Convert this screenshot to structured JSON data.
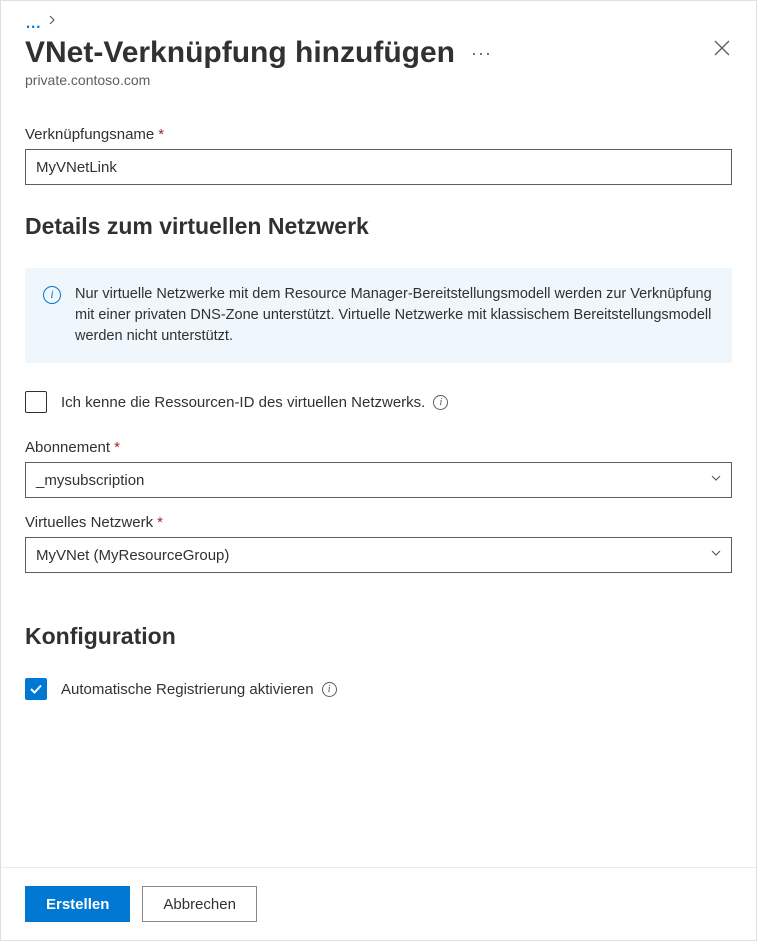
{
  "breadcrumb": {
    "more": "..."
  },
  "header": {
    "title": "VNet-Verknüpfung hinzufügen",
    "subtitle": "private.contoso.com"
  },
  "form": {
    "linkName": {
      "label": "Verknüpfungsname",
      "value": "MyVNetLink"
    },
    "vnetDetailsHeading": "Details zum virtuellen Netzwerk",
    "infoBox": "Nur virtuelle Netzwerke mit dem Resource Manager-Bereitstellungsmodell werden zur Verknüpfung mit einer privaten DNS-Zone unterstützt. Virtuelle Netzwerke mit klassischem Bereitstellungsmodell werden nicht unterstützt.",
    "knowResourceId": {
      "label": "Ich kenne die Ressourcen-ID des virtuellen Netzwerks.",
      "checked": false
    },
    "subscription": {
      "label": "Abonnement",
      "value": "_mysubscription"
    },
    "virtualNetwork": {
      "label": "Virtuelles Netzwerk",
      "value": "MyVNet (MyResourceGroup)"
    },
    "configHeading": "Konfiguration",
    "autoRegistration": {
      "label": "Automatische Registrierung aktivieren",
      "checked": true
    }
  },
  "footer": {
    "create": "Erstellen",
    "cancel": "Abbrechen"
  }
}
